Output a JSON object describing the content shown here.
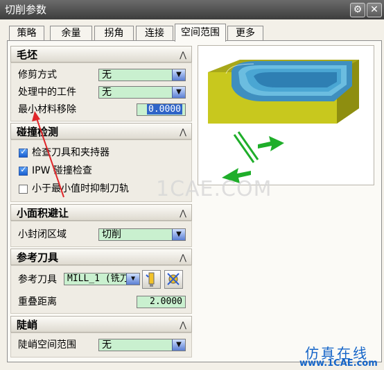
{
  "window": {
    "title": "切削参数",
    "gear_icon": "gear-icon",
    "close_icon": "close-icon"
  },
  "tabs": [
    {
      "label": "策略"
    },
    {
      "label": "余量"
    },
    {
      "label": "拐角"
    },
    {
      "label": "连接"
    },
    {
      "label": "空间范围",
      "active": true
    },
    {
      "label": "更多"
    }
  ],
  "sections": {
    "blank": {
      "title": "毛坯",
      "trim_label": "修剪方式",
      "trim_value": "无",
      "ipw_label": "处理中的工件",
      "ipw_value": "无",
      "min_removal_label": "最小材料移除",
      "min_removal_value": "0.0000"
    },
    "collision": {
      "title": "碰撞检测",
      "check_tool_label": "检查刀具和夹持器",
      "check_tool_checked": true,
      "ipw_check_label": "IPW 碰撞检查",
      "ipw_check_checked": true,
      "suppress_label": "小于最小值时抑制刀轨",
      "suppress_checked": false
    },
    "small_area": {
      "title": "小面积避让",
      "closed_label": "小封闭区域",
      "closed_value": "切削"
    },
    "ref_tool": {
      "title": "参考刀具",
      "ref_label": "参考刀具",
      "ref_value": "MILL_1 (铣刀",
      "overlap_label": "重叠距离",
      "overlap_value": "2.0000"
    },
    "steep": {
      "title": "陡峭",
      "range_label": "陡峭空间范围",
      "range_value": "无"
    }
  },
  "watermark": "1CAE.COM",
  "brand": {
    "line1": "仿真在线",
    "line2": "www.1CAE.com"
  },
  "colors": {
    "field_bg": "#c9f0cf",
    "title_bg": "#4a4a4a",
    "model_yellow": "#c8c81e",
    "model_blue": "#4ba7d6",
    "arrow_green": "#1fae2a",
    "annotation_red": "#e0262a"
  }
}
